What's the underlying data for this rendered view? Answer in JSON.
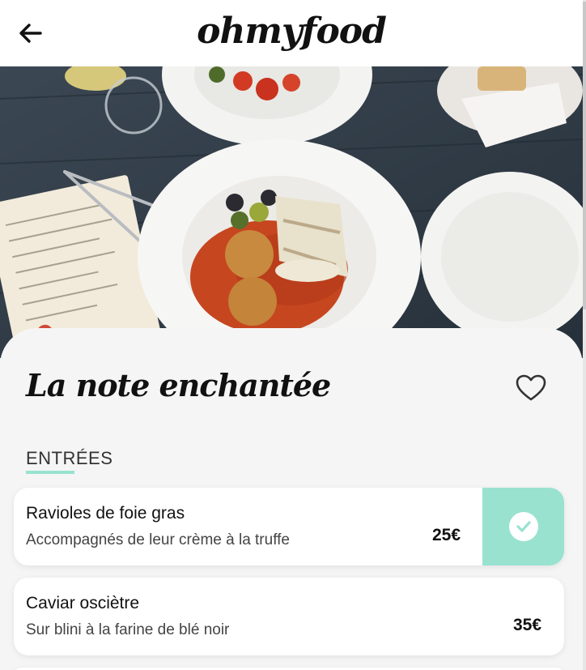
{
  "header": {
    "logo": "ohmyfood",
    "back_icon": "arrow-left-icon"
  },
  "hero": {
    "image": "restaurant-table-photo"
  },
  "restaurant": {
    "name": "La note enchantée",
    "favorite_icon": "heart-outline-icon"
  },
  "menu": {
    "section_title": "ENTRÉES",
    "dishes": [
      {
        "name": "Ravioles de foie gras",
        "description": "Accompagnés de leur crème à la truffe",
        "price": "25€",
        "selected": true,
        "check_icon": "check-circle-icon"
      },
      {
        "name": "Caviar osciètre",
        "description": "Sur blini à la farine de blé noir",
        "price": "35€",
        "selected": false
      }
    ]
  },
  "colors": {
    "accent": "#99e2d0",
    "background": "#f5f5f5",
    "text": "#111111"
  }
}
